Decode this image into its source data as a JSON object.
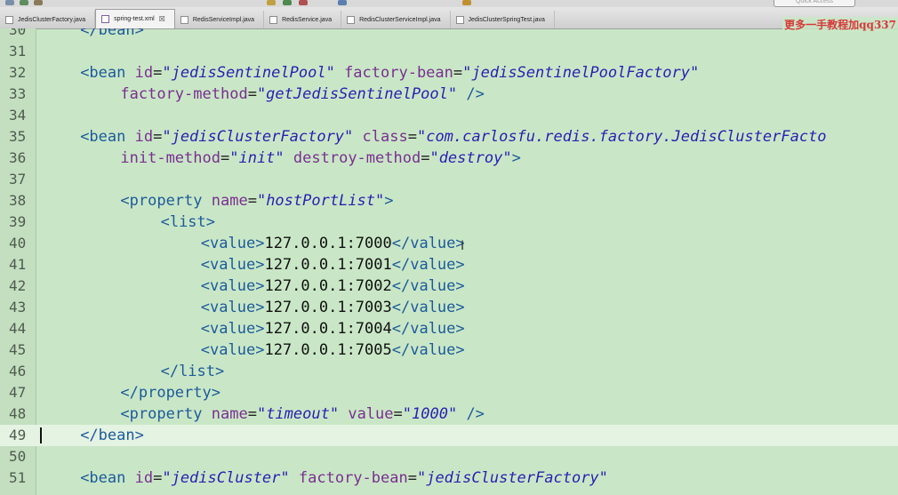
{
  "toolbar": {
    "quick_access_placeholder": "Quick Access"
  },
  "tabs": [
    {
      "label": "JedisClusterFactory.java",
      "type": "java",
      "active": false
    },
    {
      "label": "spring-test.xml",
      "type": "xml",
      "active": true,
      "close": "☒"
    },
    {
      "label": "RedisServiceImpl.java",
      "type": "java",
      "active": false
    },
    {
      "label": "RedisService.java",
      "type": "java",
      "active": false
    },
    {
      "label": "RedisClusterServiceImpl.java",
      "type": "java",
      "active": false
    },
    {
      "label": "JedisClusterSpringTest.java",
      "type": "java",
      "active": false
    }
  ],
  "watermark": "更多一手教程加qq337",
  "editor": {
    "current_line": 49,
    "lines": [
      {
        "n": "30",
        "indent": 4,
        "segs": [
          [
            "t",
            "</bean>"
          ]
        ]
      },
      {
        "n": "31",
        "indent": 0,
        "segs": []
      },
      {
        "n": "32",
        "indent": 4,
        "segs": [
          [
            "t",
            "<bean "
          ],
          [
            "a",
            "id"
          ],
          [
            "b",
            "="
          ],
          [
            "s",
            "\"jedisSentinelPool\""
          ],
          [
            "b",
            " "
          ],
          [
            "a",
            "factory-bean"
          ],
          [
            "b",
            "="
          ],
          [
            "s",
            "\"jedisSentinelPoolFactory\""
          ]
        ]
      },
      {
        "n": "33",
        "indent": 8,
        "segs": [
          [
            "a",
            "factory-method"
          ],
          [
            "b",
            "="
          ],
          [
            "s",
            "\"getJedisSentinelPool\""
          ],
          [
            "b",
            " "
          ],
          [
            "t",
            "/>"
          ]
        ]
      },
      {
        "n": "34",
        "indent": 0,
        "segs": []
      },
      {
        "n": "35",
        "indent": 4,
        "segs": [
          [
            "t",
            "<bean "
          ],
          [
            "a",
            "id"
          ],
          [
            "b",
            "="
          ],
          [
            "s",
            "\"jedisClusterFactory\""
          ],
          [
            "b",
            " "
          ],
          [
            "a",
            "class"
          ],
          [
            "b",
            "="
          ],
          [
            "s",
            "\"com.carlosfu.redis.factory.JedisClusterFacto"
          ]
        ]
      },
      {
        "n": "36",
        "indent": 8,
        "segs": [
          [
            "a",
            "init-method"
          ],
          [
            "b",
            "="
          ],
          [
            "s",
            "\"init\""
          ],
          [
            "b",
            " "
          ],
          [
            "a",
            "destroy-method"
          ],
          [
            "b",
            "="
          ],
          [
            "s",
            "\"destroy\""
          ],
          [
            "t",
            ">"
          ]
        ]
      },
      {
        "n": "37",
        "indent": 0,
        "segs": []
      },
      {
        "n": "38",
        "indent": 8,
        "segs": [
          [
            "t",
            "<property "
          ],
          [
            "a",
            "name"
          ],
          [
            "b",
            "="
          ],
          [
            "s",
            "\"hostPortList\""
          ],
          [
            "t",
            ">"
          ]
        ]
      },
      {
        "n": "39",
        "indent": 12,
        "segs": [
          [
            "t",
            "<list>"
          ]
        ]
      },
      {
        "n": "40",
        "indent": 16,
        "segs": [
          [
            "t",
            "<value>"
          ],
          [
            "d",
            "127.0.0.1:7000"
          ],
          [
            "t",
            "</value>"
          ]
        ]
      },
      {
        "n": "41",
        "indent": 16,
        "segs": [
          [
            "t",
            "<value>"
          ],
          [
            "d",
            "127.0.0.1:7001"
          ],
          [
            "t",
            "</value>"
          ]
        ]
      },
      {
        "n": "42",
        "indent": 16,
        "segs": [
          [
            "t",
            "<value>"
          ],
          [
            "d",
            "127.0.0.1:7002"
          ],
          [
            "t",
            "</value>"
          ]
        ]
      },
      {
        "n": "43",
        "indent": 16,
        "segs": [
          [
            "t",
            "<value>"
          ],
          [
            "d",
            "127.0.0.1:7003"
          ],
          [
            "t",
            "</value>"
          ]
        ]
      },
      {
        "n": "44",
        "indent": 16,
        "segs": [
          [
            "t",
            "<value>"
          ],
          [
            "d",
            "127.0.0.1:7004"
          ],
          [
            "t",
            "</value>"
          ]
        ]
      },
      {
        "n": "45",
        "indent": 16,
        "segs": [
          [
            "t",
            "<value>"
          ],
          [
            "d",
            "127.0.0.1:7005"
          ],
          [
            "t",
            "</value>"
          ]
        ]
      },
      {
        "n": "46",
        "indent": 12,
        "segs": [
          [
            "t",
            "</list>"
          ]
        ]
      },
      {
        "n": "47",
        "indent": 8,
        "segs": [
          [
            "t",
            "</property>"
          ]
        ]
      },
      {
        "n": "48",
        "indent": 8,
        "segs": [
          [
            "t",
            "<property "
          ],
          [
            "a",
            "name"
          ],
          [
            "b",
            "="
          ],
          [
            "s",
            "\"timeout\""
          ],
          [
            "b",
            " "
          ],
          [
            "a",
            "value"
          ],
          [
            "b",
            "="
          ],
          [
            "s",
            "\"1000\""
          ],
          [
            "b",
            " "
          ],
          [
            "t",
            "/>"
          ]
        ]
      },
      {
        "n": "49",
        "indent": 4,
        "segs": [
          [
            "t",
            "</bean>"
          ]
        ]
      },
      {
        "n": "50",
        "indent": 0,
        "segs": []
      },
      {
        "n": "51",
        "indent": 4,
        "segs": [
          [
            "t",
            "<bean "
          ],
          [
            "a",
            "id"
          ],
          [
            "b",
            "="
          ],
          [
            "s",
            "\"jedisCluster\""
          ],
          [
            "b",
            " "
          ],
          [
            "a",
            "factory-bean"
          ],
          [
            "b",
            "="
          ],
          [
            "s",
            "\"jedisClusterFactory\""
          ]
        ]
      }
    ]
  }
}
